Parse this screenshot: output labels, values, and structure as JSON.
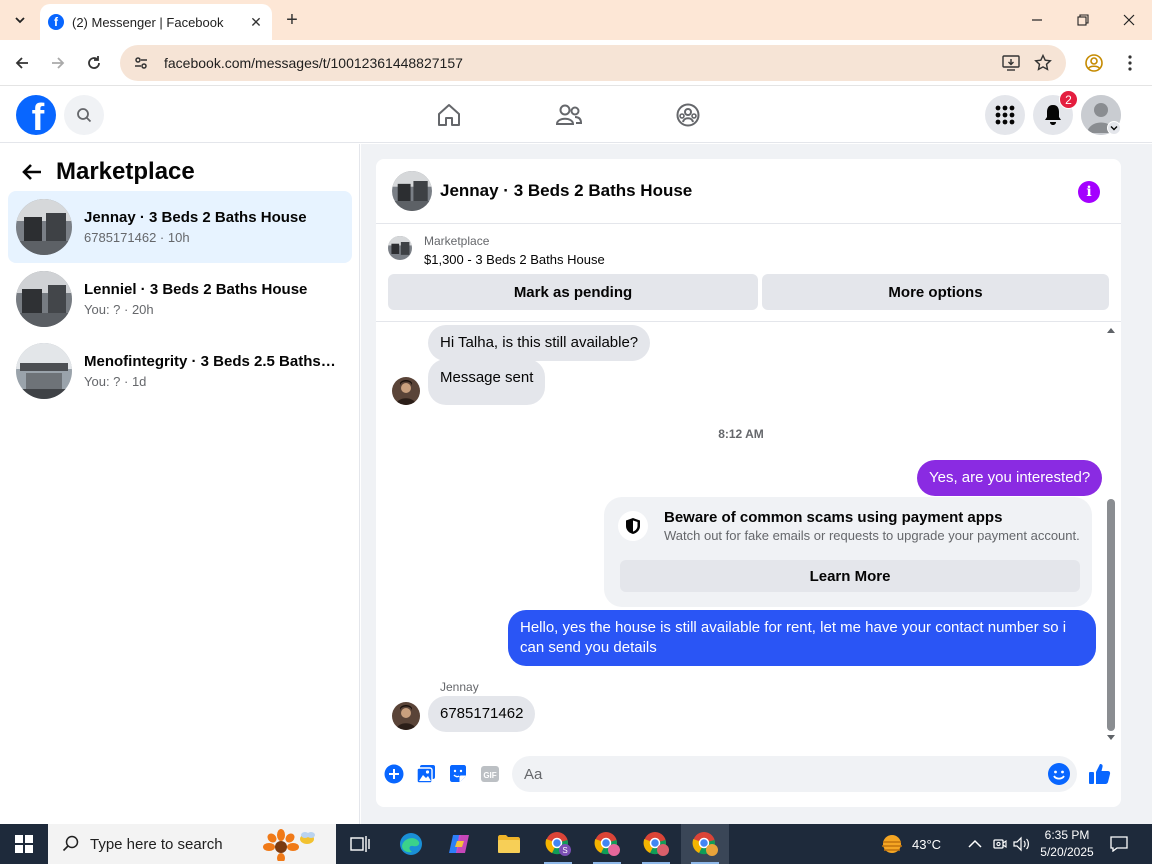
{
  "browser": {
    "tab_title": "(2) Messenger | Facebook",
    "url": "facebook.com/messages/t/10012361448827157"
  },
  "header": {
    "notification_count": "2"
  },
  "sidebar": {
    "title": "Marketplace",
    "conversations": [
      {
        "name": "Jennay · 3 Beds 2 Baths House",
        "sub": "6785171462 · 10h",
        "active": true
      },
      {
        "name": "Lenniel · 3 Beds 2 Baths House",
        "sub": "You: ? · 20h",
        "active": false
      },
      {
        "name": "Menofintegrity · 3 Beds 2.5 Baths ...",
        "sub": "You: ? · 1d",
        "active": false
      }
    ]
  },
  "chat": {
    "title": "Jennay · 3 Beds 2 Baths House",
    "listing": {
      "category": "Marketplace",
      "price_title": "$1,300 - 3 Beds 2 Baths House",
      "mark_pending_label": "Mark as pending",
      "more_options_label": "More options"
    },
    "messages": {
      "incoming_1": "Hi Talha, is this still available?",
      "incoming_2": "Message sent",
      "timestamp": "8:12 AM",
      "outgoing_1": "Yes, are you interested?",
      "outgoing_2": "Hello, yes the house is still available for rent, let me have your contact number so i can send you  details",
      "sender_name": "Jennay",
      "incoming_3": "6785171462"
    },
    "scam_notice": {
      "title": "Beware of common scams using payment apps",
      "description": "Watch out for fake emails or requests to upgrade your payment account.",
      "button_label": "Learn More"
    },
    "composer": {
      "placeholder": "Aa"
    },
    "colors": {
      "outgoing_purple": "#8a2be2",
      "outgoing_blue": "#2a55f5"
    }
  },
  "taskbar": {
    "search_placeholder": "Type here to search",
    "temperature": "43°C",
    "time": "6:35 PM",
    "date": "5/20/2025"
  }
}
